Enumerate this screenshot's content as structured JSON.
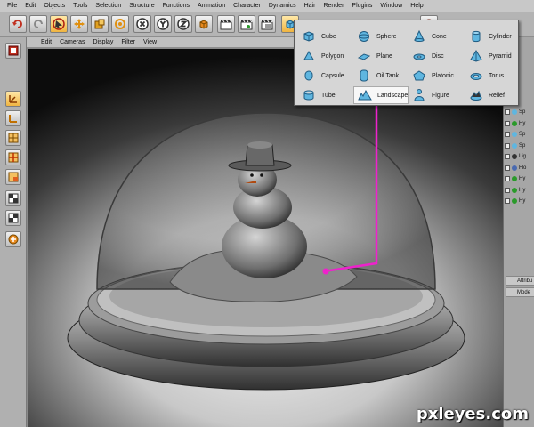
{
  "menu": [
    "File",
    "Edit",
    "Objects",
    "Tools",
    "Selection",
    "Structure",
    "Functions",
    "Animation",
    "Character",
    "Dynamics",
    "Hair",
    "Render",
    "Plugins",
    "Window",
    "Help"
  ],
  "viewport_menu": [
    "Edit",
    "Cameras",
    "Display",
    "Filter",
    "View"
  ],
  "primitives": [
    {
      "label": "Cube",
      "icon": "cube-icon"
    },
    {
      "label": "Sphere",
      "icon": "sphere-icon"
    },
    {
      "label": "Cone",
      "icon": "cone-icon"
    },
    {
      "label": "Cylinder",
      "icon": "cylinder-icon"
    },
    {
      "label": "Polygon",
      "icon": "polygon-icon"
    },
    {
      "label": "Plane",
      "icon": "plane-icon"
    },
    {
      "label": "Disc",
      "icon": "disc-icon"
    },
    {
      "label": "Pyramid",
      "icon": "pyramid-icon"
    },
    {
      "label": "Capsule",
      "icon": "capsule-icon"
    },
    {
      "label": "Oil Tank",
      "icon": "oil-tank-icon"
    },
    {
      "label": "Platonic",
      "icon": "platonic-icon"
    },
    {
      "label": "Torus",
      "icon": "torus-icon"
    },
    {
      "label": "Tube",
      "icon": "tube-icon"
    },
    {
      "label": "Landscape",
      "icon": "landscape-icon"
    },
    {
      "label": "Figure",
      "icon": "figure-icon"
    },
    {
      "label": "Relief",
      "icon": "relief-icon"
    }
  ],
  "highlighted_item": "Landscape",
  "object_tree": [
    "Sp",
    "Hy",
    "Sp",
    "Sp",
    "Lig",
    "Flo",
    "Hy",
    "Hy",
    "Hy"
  ],
  "attributes_tab": "Attribu",
  "mode_tab": "Mode",
  "watermark": "pxleyes.com",
  "colors": {
    "accent": "#ee22cc",
    "icon_blue": "#5fb6e0",
    "highlight_orange": "#f0b440"
  }
}
